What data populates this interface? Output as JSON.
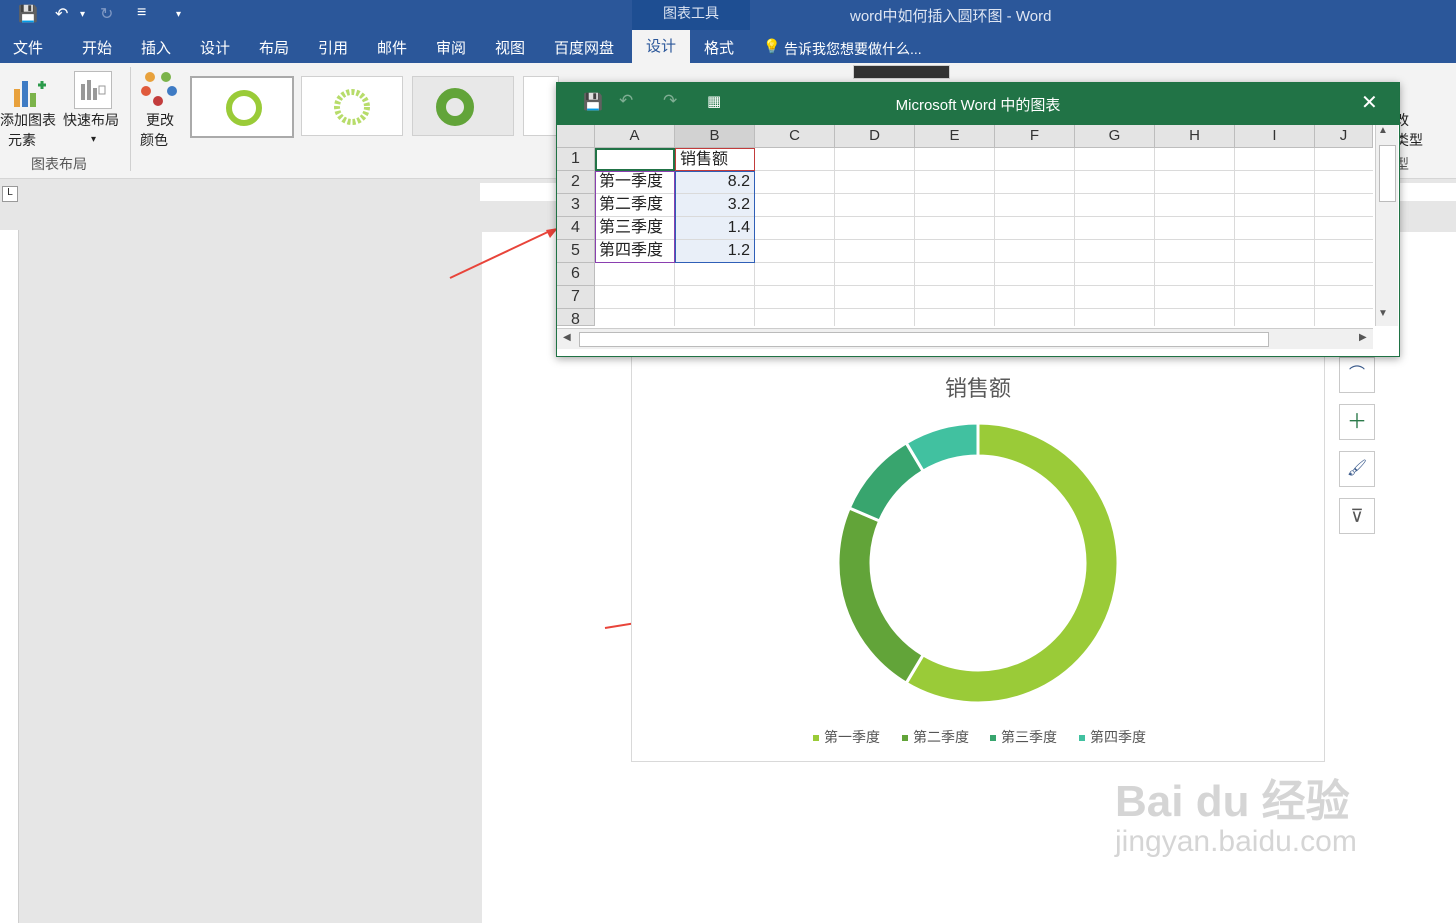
{
  "window": {
    "title": "word中如何插入圆环图 - Word",
    "context_group": "图表工具"
  },
  "tabs": [
    "文件",
    "开始",
    "插入",
    "设计",
    "布局",
    "引用",
    "邮件",
    "审阅",
    "视图",
    "百度网盘",
    "设计",
    "格式"
  ],
  "tell_me": "告诉我您想要做什么...",
  "ribbon": {
    "add_element": {
      "line1": "添加图表",
      "line2": "元素"
    },
    "quick_layout": "快速布局",
    "change_color": {
      "line1": "更改",
      "line2": "颜色"
    },
    "group_label": "图表布局",
    "right_partial": [
      "改",
      "类型",
      "型"
    ]
  },
  "excel": {
    "title": "Microsoft Word 中的图表",
    "columns": [
      "A",
      "B",
      "C",
      "D",
      "E",
      "F",
      "G",
      "H",
      "I",
      "J"
    ],
    "rows": [
      "1",
      "2",
      "3",
      "4",
      "5",
      "6",
      "7",
      "8"
    ],
    "header_b1": "销售额",
    "labels": [
      "第一季度",
      "第二季度",
      "第三季度",
      "第四季度"
    ],
    "values": [
      "8.2",
      "3.2",
      "1.4",
      "1.2"
    ]
  },
  "chart_data": {
    "type": "pie",
    "variant": "doughnut",
    "title": "销售额",
    "categories": [
      "第一季度",
      "第二季度",
      "第三季度",
      "第四季度"
    ],
    "values": [
      8.2,
      3.2,
      1.4,
      1.2
    ],
    "colors": [
      "#9acb38",
      "#62a439",
      "#38a56e",
      "#41c1a0"
    ],
    "legend": "bottom"
  },
  "watermark": {
    "line1": "Bai du 经验",
    "line2": "jingyan.baidu.com"
  }
}
